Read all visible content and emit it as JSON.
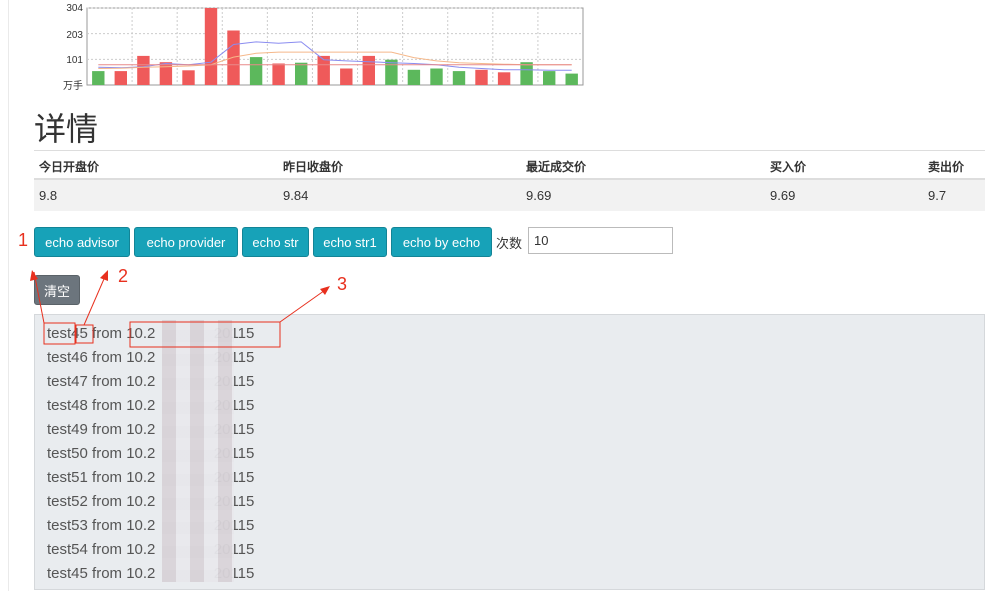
{
  "chart_data": {
    "type": "bar",
    "y_ticks": [
      "304",
      "203",
      "101"
    ],
    "y_unit_label": "万手",
    "ylim": [
      0,
      304
    ],
    "values": [
      55,
      55,
      115,
      90,
      58,
      304,
      215,
      110,
      85,
      88,
      115,
      65,
      115,
      100,
      60,
      65,
      55,
      60,
      50,
      90,
      55,
      45
    ],
    "bar_colors": [
      "g",
      "r",
      "r",
      "r",
      "r",
      "r",
      "r",
      "g",
      "r",
      "g",
      "r",
      "r",
      "r",
      "g",
      "g",
      "g",
      "g",
      "r",
      "r",
      "g",
      "g",
      "g"
    ],
    "lines": [
      {
        "color": "#8a8cf0",
        "values": [
          70,
          68,
          72,
          85,
          80,
          90,
          160,
          170,
          165,
          170,
          100,
          95,
          92,
          88,
          85,
          80,
          70,
          65,
          60,
          60,
          58,
          58
        ]
      },
      {
        "color": "#f5b88a",
        "values": [
          65,
          66,
          70,
          72,
          75,
          80,
          110,
          125,
          130,
          130,
          130,
          130,
          130,
          130,
          108,
          95,
          88,
          85,
          82,
          80,
          80,
          80
        ]
      },
      {
        "color": "#e88a8a",
        "values": [
          80,
          80,
          80,
          80,
          80,
          80,
          80,
          80,
          80,
          80,
          80,
          80,
          80,
          80,
          80,
          80,
          80,
          80,
          80,
          80,
          80,
          80
        ]
      }
    ],
    "colors": {
      "green": "#5cb85c",
      "red": "#ef5a5a"
    },
    "grid": true
  },
  "details": {
    "title": "详情",
    "columns": [
      "今日开盘价",
      "昨日收盘价",
      "最近成交价",
      "买入价",
      "卖出价"
    ],
    "values": [
      "9.8",
      "9.84",
      "9.69",
      "9.69",
      "9.7"
    ]
  },
  "buttons": {
    "echo_advisor": "echo advisor",
    "echo_provider": "echo provider",
    "echo_str": "echo str",
    "echo_str1": "echo str1",
    "echo_by_echo": "echo by echo",
    "clear": "清空"
  },
  "count": {
    "label": "次数",
    "value": "10"
  },
  "log": {
    "lines": [
      "test45 from 10.2              20115",
      "test46 from 10.2              20115",
      "test47 from 10.2              20115",
      "test48 from 10.2              20115",
      "test49 from 10.2              20115",
      "test50 from 10.2              20115",
      "test51 from 10.2              20115",
      "test52 from 10.2              20115",
      "test53 from 10.2              20115",
      "test54 from 10.2              20115",
      "test45 from 10.2              20115"
    ]
  },
  "annotations": {
    "labels": [
      "1",
      "2",
      "3"
    ],
    "color": "#e8301e"
  }
}
